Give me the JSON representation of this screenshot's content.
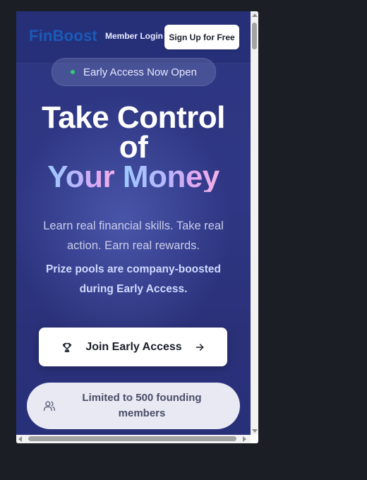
{
  "navbar": {
    "logo_text": "FinBoost",
    "login_label": "Member Login",
    "signup_label": "Sign Up for Free"
  },
  "badge": {
    "label": "Early Access Now Open"
  },
  "hero": {
    "line1": "Take Control",
    "line2": "of",
    "line3_word1": "Your",
    "line3_word2": "Money"
  },
  "subtitle": "Learn real financial skills. Take real action. Earn real rewards.",
  "highlight": "Prize pools are company-boosted during Early Access.",
  "cta": {
    "label": "Join Early Access",
    "icon_left": "trophy-icon",
    "icon_right": "arrow-right-icon"
  },
  "limit_notice": {
    "label": "Limited to 500 founding members",
    "icon": "users-icon"
  },
  "colors": {
    "background": "#2c3680",
    "accent_gradient_start": "#9cc9ff",
    "accent_gradient_end": "#f0b2e8",
    "status_dot": "#2ecc71",
    "logo": "#1a5ab8"
  }
}
